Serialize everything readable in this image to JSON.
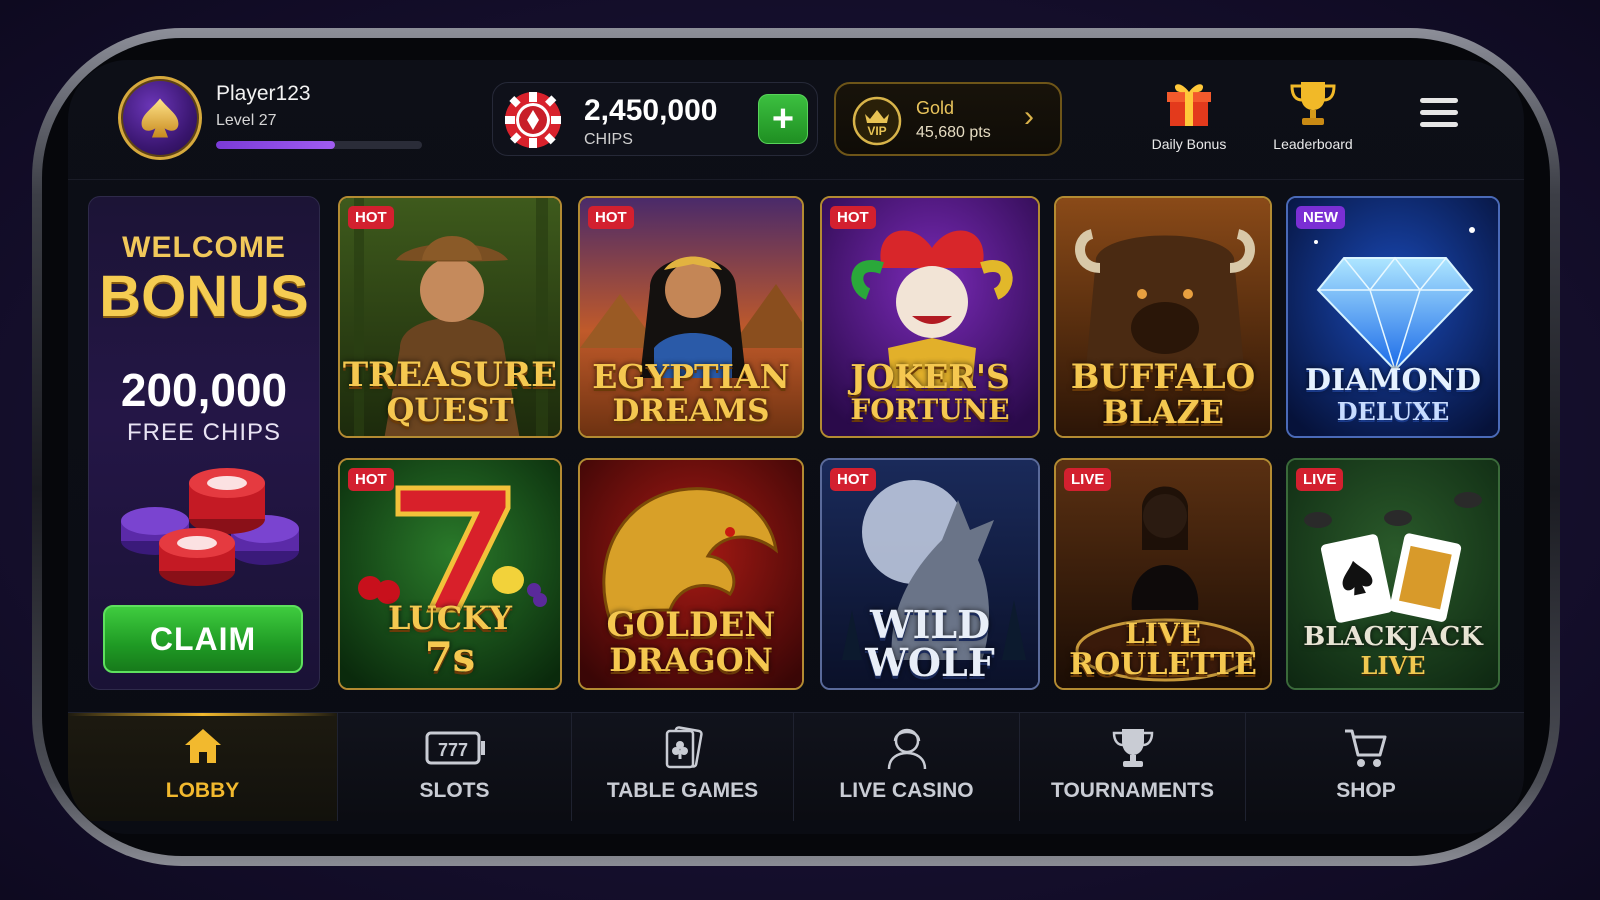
{
  "player": {
    "name": "Player123",
    "level": "Level 27",
    "xp_progress": 0.58
  },
  "chips": {
    "amount": "2,450,000",
    "label": "CHIPS",
    "add_label": "+"
  },
  "vip": {
    "badge": "VIP",
    "tier": "Gold",
    "points": "45,680 pts"
  },
  "top_actions": [
    {
      "label": "Daily Bonus",
      "icon": "gift-icon"
    },
    {
      "label": "Leaderboard",
      "icon": "trophy-icon"
    }
  ],
  "welcome": {
    "line1": "WELCOME",
    "line2": "BONUS",
    "amount": "200,000",
    "sub": "FREE CHIPS",
    "claim": "CLAIM"
  },
  "games": [
    {
      "title1": "TREASURE",
      "title2": "QUEST",
      "badge": "HOT"
    },
    {
      "title1": "EGYPTIAN",
      "title2": "DREAMS",
      "badge": "HOT"
    },
    {
      "title1": "JOKER'S",
      "title2": "FORTUNE",
      "badge": "HOT"
    },
    {
      "title1": "BUFFALO",
      "title2": "BLAZE",
      "badge": ""
    },
    {
      "title1": "DIAMOND",
      "title2": "DELUXE",
      "badge": "NEW"
    },
    {
      "title1": "LUCKY",
      "title2": "7s",
      "badge": "HOT"
    },
    {
      "title1": "GOLDEN",
      "title2": "DRAGON",
      "badge": ""
    },
    {
      "title1": "WILD",
      "title2": "WOLF",
      "badge": "HOT"
    },
    {
      "title1": "LIVE",
      "title2": "ROULETTE",
      "badge": "LIVE"
    },
    {
      "title1": "BLACKJACK",
      "title2": "LIVE",
      "badge": "LIVE"
    }
  ],
  "nav": [
    {
      "label": "LOBBY",
      "icon": "home-icon",
      "active": true
    },
    {
      "label": "SLOTS",
      "icon": "slot-machine-icon",
      "active": false
    },
    {
      "label": "TABLE GAMES",
      "icon": "playing-cards-icon",
      "active": false
    },
    {
      "label": "LIVE CASINO",
      "icon": "dealer-icon",
      "active": false
    },
    {
      "label": "TOURNAMENTS",
      "icon": "trophy-icon",
      "active": false
    },
    {
      "label": "SHOP",
      "icon": "cart-icon",
      "active": false
    }
  ],
  "colors": {
    "gold": "#f2b92e",
    "green": "#2fb534",
    "purple": "#7a3ad8",
    "hot": "#d3202f"
  }
}
